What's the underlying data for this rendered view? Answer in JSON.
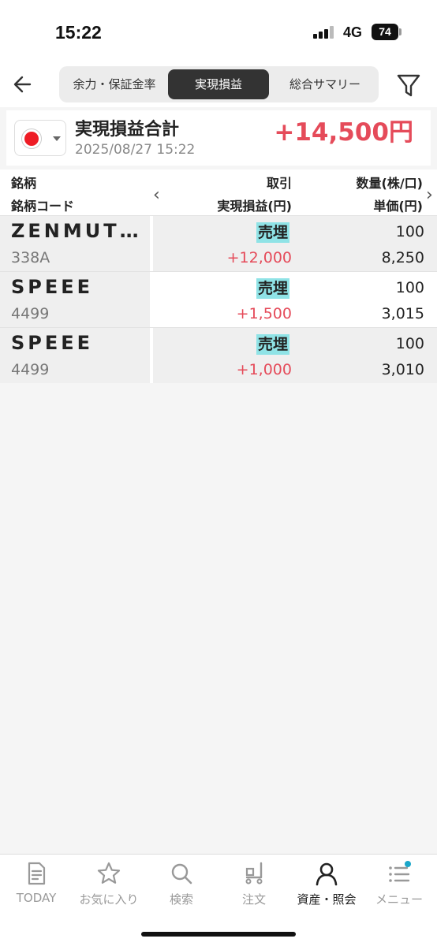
{
  "status_bar": {
    "time": "15:22",
    "network": "4G",
    "battery": "74"
  },
  "nav": {
    "tabs": [
      {
        "label": "余力・保証金率",
        "active": false
      },
      {
        "label": "実現損益",
        "active": true
      },
      {
        "label": "総合サマリー",
        "active": false
      }
    ]
  },
  "summary": {
    "title": "実現損益合計",
    "date": "2025/08/27 15:22",
    "amount": "+14,500円"
  },
  "table": {
    "headers": {
      "name": "銘柄",
      "code": "銘柄コード",
      "trade": "取引",
      "pnl": "実現損益(円)",
      "qty": "数量(株/口)",
      "price": "単価(円)"
    },
    "rows": [
      {
        "name": "ZENMUT…",
        "code": "338A",
        "trade": "売埋",
        "pnl": "+12,000",
        "qty": "100",
        "price": "8,250"
      },
      {
        "name": "SPEEE",
        "code": "4499",
        "trade": "売埋",
        "pnl": "+1,500",
        "qty": "100",
        "price": "3,015"
      },
      {
        "name": "SPEEE",
        "code": "4499",
        "trade": "売埋",
        "pnl": "+1,000",
        "qty": "100",
        "price": "3,010"
      }
    ]
  },
  "tabbar": {
    "items": [
      {
        "label": "TODAY",
        "icon": "document-icon"
      },
      {
        "label": "お気に入り",
        "icon": "star-icon"
      },
      {
        "label": "検索",
        "icon": "search-icon"
      },
      {
        "label": "注文",
        "icon": "cart-icon"
      },
      {
        "label": "資産・照会",
        "icon": "person-icon",
        "active": true
      },
      {
        "label": "メニュー",
        "icon": "menu-icon"
      }
    ]
  },
  "colors": {
    "profit": "#e54b5a",
    "badge": "#8fe3e6",
    "active_tab": "#333333",
    "notification_dot": "#1aa6c9"
  }
}
